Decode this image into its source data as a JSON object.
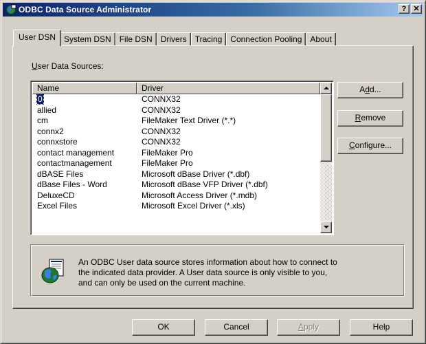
{
  "window": {
    "title": "ODBC Data Source Administrator",
    "help_button": "?",
    "close_button": "✕"
  },
  "tabs": [
    {
      "label": "User DSN",
      "active": true
    },
    {
      "label": "System DSN",
      "active": false
    },
    {
      "label": "File DSN",
      "active": false
    },
    {
      "label": "Drivers",
      "active": false
    },
    {
      "label": "Tracing",
      "active": false
    },
    {
      "label": "Connection Pooling",
      "active": false
    },
    {
      "label": "About",
      "active": false
    }
  ],
  "list": {
    "label_prefix": "U",
    "label_rest": "ser Data Sources:",
    "columns": {
      "name": "Name",
      "driver": "Driver"
    },
    "rows": [
      {
        "name": "0",
        "driver": "CONNX32",
        "selected": true
      },
      {
        "name": "allied",
        "driver": "CONNX32"
      },
      {
        "name": "cm",
        "driver": "FileMaker Text Driver (*.*)"
      },
      {
        "name": "connx2",
        "driver": "CONNX32"
      },
      {
        "name": "connxstore",
        "driver": "CONNX32"
      },
      {
        "name": "contact management",
        "driver": "FileMaker Pro"
      },
      {
        "name": "contactmanagement",
        "driver": "FileMaker Pro"
      },
      {
        "name": "dBASE Files",
        "driver": "Microsoft dBase Driver (*.dbf)"
      },
      {
        "name": "dBase Files - Word",
        "driver": "Microsoft dBase VFP Driver (*.dbf)"
      },
      {
        "name": "DeluxeCD",
        "driver": "Microsoft Access Driver (*.mdb)"
      },
      {
        "name": "Excel Files",
        "driver": "Microsoft Excel Driver (*.xls)"
      }
    ]
  },
  "buttons": {
    "add": {
      "pre": "A",
      "u": "d",
      "post": "d..."
    },
    "remove": {
      "pre": "",
      "u": "R",
      "post": "emove"
    },
    "configure": {
      "pre": "",
      "u": "C",
      "post": "onfigure..."
    }
  },
  "info": {
    "line1": "An ODBC User data source stores information about how to connect to",
    "line2": "the indicated data provider.   A User data source is only visible to you,",
    "line3": "and can only be used on the current machine."
  },
  "bottom_buttons": {
    "ok": "OK",
    "cancel": "Cancel",
    "apply": {
      "u": "A",
      "post": "pply"
    },
    "help": "Help"
  },
  "colors": {
    "face": "#d4d0c8",
    "title_start": "#0a246a",
    "title_end": "#a6caf0",
    "selection": "#0a246a"
  }
}
